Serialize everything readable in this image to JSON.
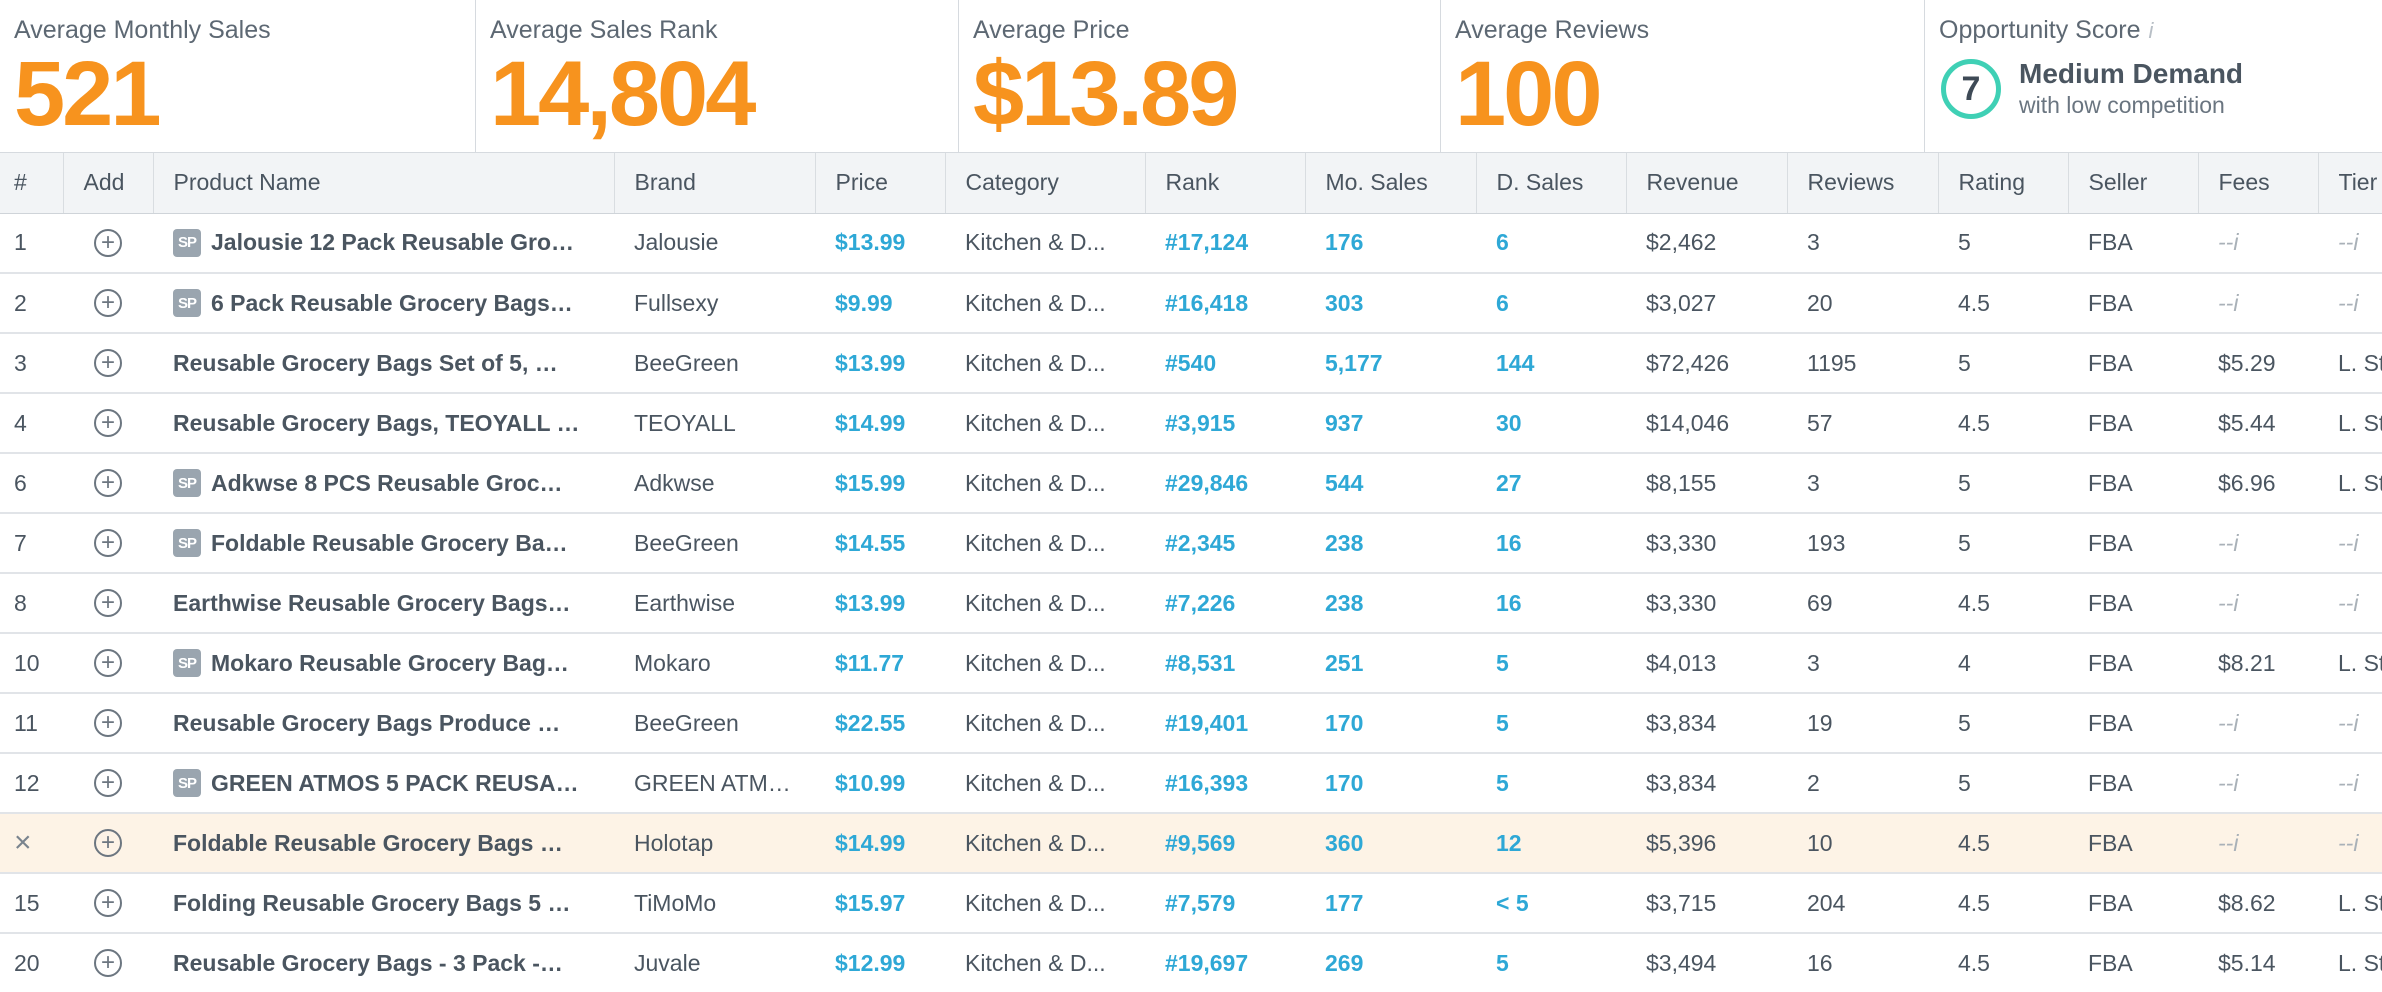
{
  "stats": {
    "avg_monthly_sales": {
      "label": "Average Monthly Sales",
      "value": "521"
    },
    "avg_sales_rank": {
      "label": "Average Sales Rank",
      "value": "14,804"
    },
    "avg_price": {
      "label": "Average Price",
      "value": "$13.89"
    },
    "avg_reviews": {
      "label": "Average Reviews",
      "value": "100"
    },
    "opportunity": {
      "label": "Opportunity Score",
      "info": "i",
      "score": "7",
      "title": "Medium Demand",
      "subtitle": "with low competition"
    }
  },
  "table": {
    "headers": {
      "num": "#",
      "add": "Add",
      "name": "Product Name",
      "brand": "Brand",
      "price": "Price",
      "category": "Category",
      "rank": "Rank",
      "mo_sales": "Mo. Sales",
      "d_sales": "D. Sales",
      "revenue": "Revenue",
      "reviews": "Reviews",
      "rating": "Rating",
      "seller": "Seller",
      "fees": "Fees",
      "tier": "Tier"
    },
    "rows": [
      {
        "num": "1",
        "sp": true,
        "name": "Jalousie 12 Pack Reusable Gro…",
        "brand": "Jalousie",
        "price": "$13.99",
        "category": "Kitchen & D...",
        "rank": "#17,124",
        "mo_sales": "176",
        "d_sales": "6",
        "revenue": "$2,462",
        "reviews": "3",
        "rating": "5",
        "seller": "FBA",
        "fees": "--i",
        "tier": "--i"
      },
      {
        "num": "2",
        "sp": true,
        "name": "6 Pack Reusable Grocery Bags…",
        "brand": "Fullsexy",
        "price": "$9.99",
        "category": "Kitchen & D...",
        "rank": "#16,418",
        "mo_sales": "303",
        "d_sales": "6",
        "revenue": "$3,027",
        "reviews": "20",
        "rating": "4.5",
        "seller": "FBA",
        "fees": "--i",
        "tier": "--i"
      },
      {
        "num": "3",
        "sp": false,
        "name": "Reusable Grocery Bags Set of 5, …",
        "brand": "BeeGreen",
        "price": "$13.99",
        "category": "Kitchen & D...",
        "rank": "#540",
        "mo_sales": "5,177",
        "d_sales": "144",
        "revenue": "$72,426",
        "reviews": "1195",
        "rating": "5",
        "seller": "FBA",
        "fees": "$5.29",
        "tier": "L. St"
      },
      {
        "num": "4",
        "sp": false,
        "name": "Reusable Grocery Bags, TEOYALL …",
        "brand": "TEOYALL",
        "price": "$14.99",
        "category": "Kitchen & D...",
        "rank": "#3,915",
        "mo_sales": "937",
        "d_sales": "30",
        "revenue": "$14,046",
        "reviews": "57",
        "rating": "4.5",
        "seller": "FBA",
        "fees": "$5.44",
        "tier": "L. St"
      },
      {
        "num": "6",
        "sp": true,
        "name": "Adkwse 8 PCS Reusable Groc…",
        "brand": "Adkwse",
        "price": "$15.99",
        "category": "Kitchen & D...",
        "rank": "#29,846",
        "mo_sales": "544",
        "d_sales": "27",
        "revenue": "$8,155",
        "reviews": "3",
        "rating": "5",
        "seller": "FBA",
        "fees": "$6.96",
        "tier": "L. St"
      },
      {
        "num": "7",
        "sp": true,
        "name": "Foldable Reusable Grocery Ba…",
        "brand": "BeeGreen",
        "price": "$14.55",
        "category": "Kitchen & D...",
        "rank": "#2,345",
        "mo_sales": "238",
        "d_sales": "16",
        "revenue": "$3,330",
        "reviews": "193",
        "rating": "5",
        "seller": "FBA",
        "fees": "--i",
        "tier": "--i"
      },
      {
        "num": "8",
        "sp": false,
        "name": "Earthwise Reusable Grocery Bags…",
        "brand": "Earthwise",
        "price": "$13.99",
        "category": "Kitchen & D...",
        "rank": "#7,226",
        "mo_sales": "238",
        "d_sales": "16",
        "revenue": "$3,330",
        "reviews": "69",
        "rating": "4.5",
        "seller": "FBA",
        "fees": "--i",
        "tier": "--i"
      },
      {
        "num": "10",
        "sp": true,
        "name": "Mokaro Reusable Grocery Bag…",
        "brand": "Mokaro",
        "price": "$11.77",
        "category": "Kitchen & D...",
        "rank": "#8,531",
        "mo_sales": "251",
        "d_sales": "5",
        "revenue": "$4,013",
        "reviews": "3",
        "rating": "4",
        "seller": "FBA",
        "fees": "$8.21",
        "tier": "L. St"
      },
      {
        "num": "11",
        "sp": false,
        "name": "Reusable Grocery Bags Produce …",
        "brand": "BeeGreen",
        "price": "$22.55",
        "category": "Kitchen & D...",
        "rank": "#19,401",
        "mo_sales": "170",
        "d_sales": "5",
        "revenue": "$3,834",
        "reviews": "19",
        "rating": "5",
        "seller": "FBA",
        "fees": "--i",
        "tier": "--i"
      },
      {
        "num": "12",
        "sp": true,
        "name": "GREEN ATMOS 5 PACK REUSA…",
        "brand": "GREEN ATM…",
        "price": "$10.99",
        "category": "Kitchen & D...",
        "rank": "#16,393",
        "mo_sales": "170",
        "d_sales": "5",
        "revenue": "$3,834",
        "reviews": "2",
        "rating": "5",
        "seller": "FBA",
        "fees": "--i",
        "tier": "--i"
      },
      {
        "num": "×",
        "sp": false,
        "highlight": true,
        "name": "Foldable Reusable Grocery Bags …",
        "brand": "Holotap",
        "price": "$14.99",
        "category": "Kitchen & D...",
        "rank": "#9,569",
        "mo_sales": "360",
        "d_sales": "12",
        "revenue": "$5,396",
        "reviews": "10",
        "rating": "4.5",
        "seller": "FBA",
        "fees": "--i",
        "tier": "--i"
      },
      {
        "num": "15",
        "sp": false,
        "name": "Folding Reusable Grocery Bags 5 …",
        "brand": "TiMoMo",
        "price": "$15.97",
        "category": "Kitchen & D...",
        "rank": "#7,579",
        "mo_sales": "177",
        "d_sales": "< 5",
        "revenue": "$3,715",
        "reviews": "204",
        "rating": "4.5",
        "seller": "FBA",
        "fees": "$8.62",
        "tier": "L. St"
      },
      {
        "num": "20",
        "sp": false,
        "name": "Reusable Grocery Bags - 3 Pack -…",
        "brand": "Juvale",
        "price": "$12.99",
        "category": "Kitchen & D...",
        "rank": "#19,697",
        "mo_sales": "269",
        "d_sales": "5",
        "revenue": "$3,494",
        "reviews": "16",
        "rating": "4.5",
        "seller": "FBA",
        "fees": "$5.14",
        "tier": "L. St"
      }
    ]
  },
  "icons": {
    "add": "plus-circle-icon",
    "sponsored": "sp-badge-icon",
    "remove": "close-icon"
  },
  "badge_text": "SP",
  "add_glyph": "+",
  "colors": {
    "accent_orange": "#f7931e",
    "link_blue": "#2ea8d6",
    "score_ring": "#3fd0b5",
    "highlight_row": "#fdf3e6"
  }
}
